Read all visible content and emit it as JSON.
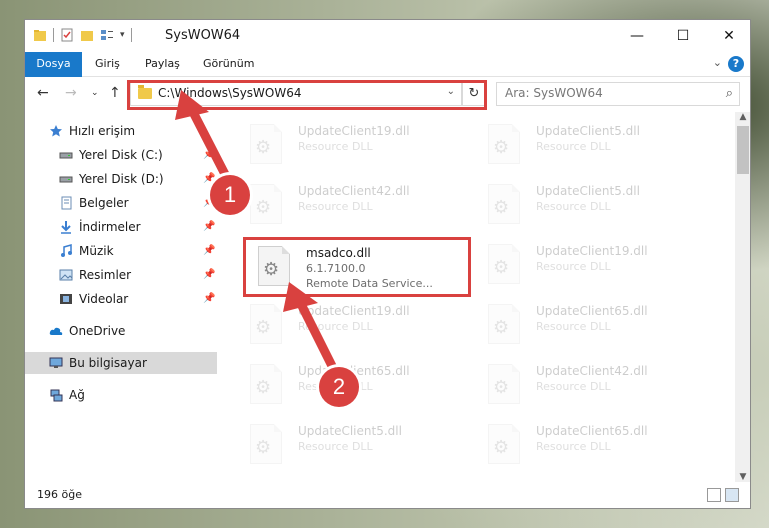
{
  "window": {
    "title": "SysWOW64",
    "controls": {
      "minimize": "—",
      "maximize": "☐",
      "close": "✕"
    }
  },
  "ribbon": {
    "tabs": [
      "Dosya",
      "Giriş",
      "Paylaş",
      "Görünüm"
    ]
  },
  "navigation": {
    "address": "C:\\Windows\\SysWOW64",
    "search_placeholder": "Ara: SysWOW64"
  },
  "sidebar": {
    "items": [
      {
        "label": "Hızlı erişim",
        "icon": "star-icon",
        "pinned": false,
        "selected": false
      },
      {
        "label": "Yerel Disk (C:)",
        "icon": "drive-icon",
        "pinned": true,
        "selected": false
      },
      {
        "label": "Yerel Disk (D:)",
        "icon": "drive-icon",
        "pinned": true,
        "selected": false
      },
      {
        "label": "Belgeler",
        "icon": "documents-icon",
        "pinned": true,
        "selected": false
      },
      {
        "label": "İndirmeler",
        "icon": "download-icon",
        "pinned": true,
        "selected": false
      },
      {
        "label": "Müzik",
        "icon": "music-icon",
        "pinned": true,
        "selected": false
      },
      {
        "label": "Resimler",
        "icon": "pictures-icon",
        "pinned": true,
        "selected": false
      },
      {
        "label": "Videolar",
        "icon": "videos-icon",
        "pinned": true,
        "selected": false
      },
      {
        "label": "OneDrive",
        "icon": "cloud-icon",
        "pinned": false,
        "selected": false
      },
      {
        "label": "Bu bilgisayar",
        "icon": "computer-icon",
        "pinned": false,
        "selected": true
      },
      {
        "label": "Ağ",
        "icon": "network-icon",
        "pinned": false,
        "selected": false
      }
    ]
  },
  "files": {
    "highlighted": {
      "name": "msadco.dll",
      "version": "6.1.7100.0",
      "description": "Remote Data Service..."
    },
    "background": [
      {
        "name": "UpdateClient19.dll",
        "type": "Resource DLL"
      },
      {
        "name": "UpdateClient5.dll",
        "type": "Resource DLL"
      },
      {
        "name": "UpdateClient42.dll",
        "type": "Resource DLL"
      },
      {
        "name": "UpdateClient5.dll",
        "type": "Resource DLL"
      },
      {
        "name": "UpdateClient19.dll",
        "type": "Resource DLL"
      },
      {
        "name": "UpdateClient19.dll",
        "type": "Resource DLL"
      },
      {
        "name": "UpdateClient65.dll",
        "type": "Resource DLL"
      },
      {
        "name": "UpdateClient65.dll",
        "type": "Resource DLL"
      },
      {
        "name": "UpdateClient42.dll",
        "type": "Resource DLL"
      },
      {
        "name": "UpdateClient5.dll",
        "type": "Resource DLL"
      },
      {
        "name": "UpdateClient65.dll",
        "type": "Resource DLL"
      }
    ]
  },
  "status": {
    "count": "196 öğe"
  },
  "annotations": {
    "step1": "1",
    "step2": "2",
    "color": "#d9413f"
  }
}
